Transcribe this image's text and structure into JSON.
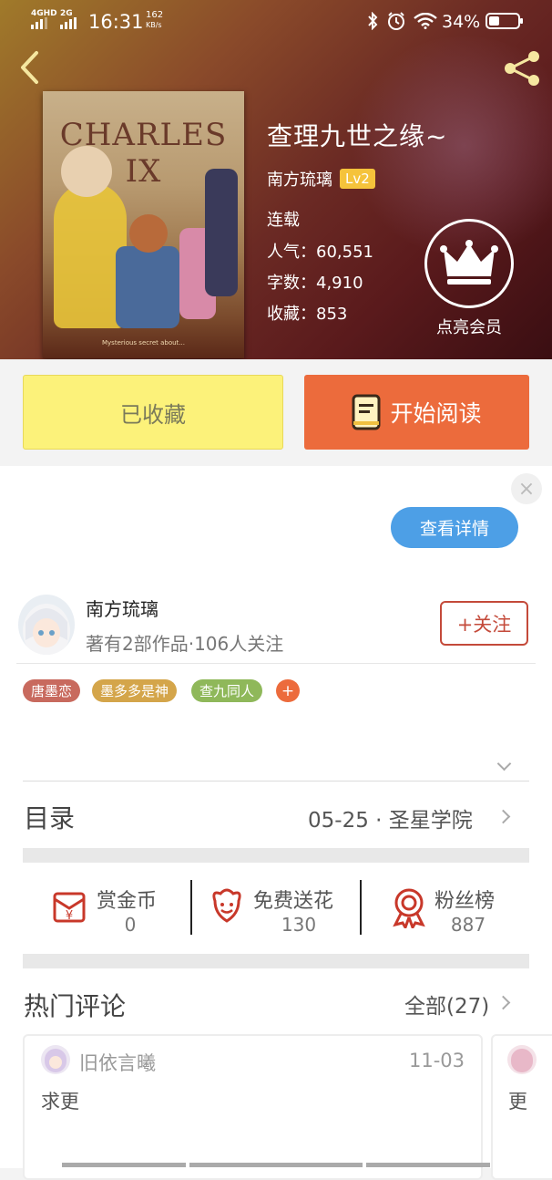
{
  "status_bar": {
    "network1": "4GHD",
    "network2": "2G",
    "time": "16:31",
    "speed_value": "162",
    "speed_unit": "KB/s",
    "battery": "34%"
  },
  "book": {
    "cover_title": "CHARLES IX",
    "cover_subtitle": "Mysterious secret about...",
    "title": "查理九世之缘~",
    "author": "南方琉璃",
    "author_level": "Lv2",
    "status": "连载",
    "popularity_label": "人气：",
    "popularity": "60,551",
    "words_label": "字数：",
    "words": "4,910",
    "favorites_label": "收藏：",
    "favorites": "853",
    "member_label": "点亮会员"
  },
  "actions": {
    "favorited_label": "已收藏",
    "read_label": "开始阅读"
  },
  "ad": {
    "close": "×",
    "details_label": "查看详情"
  },
  "author_card": {
    "name": "南方琉璃",
    "stats": "著有2部作品·106人关注",
    "follow_label": "+关注"
  },
  "tags": [
    {
      "label": "唐墨恋",
      "color": "#c86a5e"
    },
    {
      "label": "墨多多是神",
      "color": "#d4a54a"
    },
    {
      "label": "查九同人",
      "color": "#8fb85a"
    },
    {
      "label": "+",
      "color": "#ec6b3c"
    }
  ],
  "catalog": {
    "title": "目录",
    "latest": "05-25 · 圣星学院"
  },
  "stats": [
    {
      "label": "赏金币",
      "value": "0",
      "icon": "coin-envelope-icon"
    },
    {
      "label": "免费送花",
      "value": "130",
      "icon": "flower-icon"
    },
    {
      "label": "粉丝榜",
      "value": "887",
      "icon": "medal-icon"
    }
  ],
  "comments": {
    "title": "热门评论",
    "all_label": "全部(27)",
    "items": [
      {
        "user": "旧依言曦",
        "date": "11-03",
        "text": "求更"
      },
      {
        "user": "",
        "date": "",
        "text": "更"
      }
    ]
  },
  "colors": {
    "accent_orange": "#ec6b3c",
    "fav_yellow": "#fcf27a",
    "follow_red": "#c44a3a",
    "ad_blue": "#4d9fe6"
  }
}
